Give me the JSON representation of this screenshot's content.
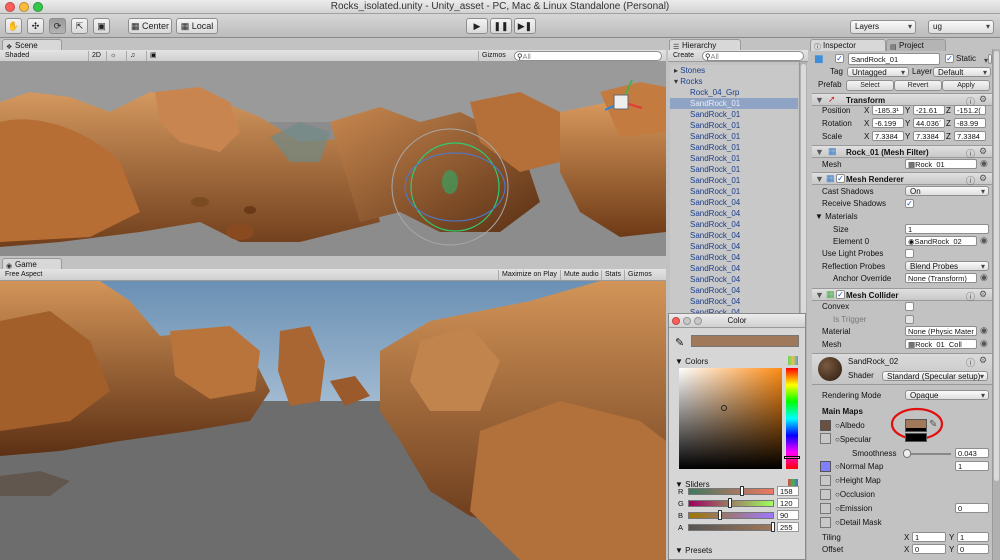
{
  "window": {
    "title": "Rocks_isolated.unity - Unity_asset - PC, Mac & Linux Standalone (Personal)"
  },
  "toolbar": {
    "pivot_label": "Center",
    "space_label": "Local",
    "layers_label": "Layers",
    "layout_label": "ug"
  },
  "scene": {
    "tab": "Scene",
    "shading": "Shaded",
    "mode_2d": "2D",
    "gizmos": "Gizmos",
    "search_placeholder": "All"
  },
  "game": {
    "tab": "Game",
    "aspect": "Free Aspect",
    "buttons": [
      "Maximize on Play",
      "Mute audio",
      "Stats",
      "Gizmos"
    ]
  },
  "hierarchy": {
    "tab": "Hierarchy",
    "create": "Create",
    "search_placeholder": "All",
    "items": [
      {
        "label": "Stones",
        "indent": 0,
        "expand": "closed",
        "selected": false
      },
      {
        "label": "Rocks",
        "indent": 0,
        "expand": "open",
        "selected": false
      },
      {
        "label": "Rock_04_Grp",
        "indent": 1,
        "expand": "",
        "selected": false
      },
      {
        "label": "SandRock_01",
        "indent": 1,
        "expand": "",
        "selected": true
      },
      {
        "label": "SandRock_01",
        "indent": 1,
        "expand": "",
        "selected": false
      },
      {
        "label": "SandRock_01",
        "indent": 1,
        "expand": "",
        "selected": false
      },
      {
        "label": "SandRock_01",
        "indent": 1,
        "expand": "",
        "selected": false
      },
      {
        "label": "SandRock_01",
        "indent": 1,
        "expand": "",
        "selected": false
      },
      {
        "label": "SandRock_01",
        "indent": 1,
        "expand": "",
        "selected": false
      },
      {
        "label": "SandRock_01",
        "indent": 1,
        "expand": "",
        "selected": false
      },
      {
        "label": "SandRock_01",
        "indent": 1,
        "expand": "",
        "selected": false
      },
      {
        "label": "SandRock_01",
        "indent": 1,
        "expand": "",
        "selected": false
      },
      {
        "label": "SandRock_04",
        "indent": 1,
        "expand": "",
        "selected": false
      },
      {
        "label": "SandRock_04",
        "indent": 1,
        "expand": "",
        "selected": false
      },
      {
        "label": "SandRock_04",
        "indent": 1,
        "expand": "",
        "selected": false
      },
      {
        "label": "SandRock_04",
        "indent": 1,
        "expand": "",
        "selected": false
      },
      {
        "label": "SandRock_04",
        "indent": 1,
        "expand": "",
        "selected": false
      },
      {
        "label": "SandRock_04",
        "indent": 1,
        "expand": "",
        "selected": false
      },
      {
        "label": "SandRock_04",
        "indent": 1,
        "expand": "",
        "selected": false
      },
      {
        "label": "SandRock_04",
        "indent": 1,
        "expand": "",
        "selected": false
      },
      {
        "label": "SandRock_04",
        "indent": 1,
        "expand": "",
        "selected": false
      },
      {
        "label": "SandRock_04",
        "indent": 1,
        "expand": "",
        "selected": false
      },
      {
        "label": "SandRock_04",
        "indent": 1,
        "expand": "",
        "selected": false
      }
    ]
  },
  "color_picker": {
    "title": "Color",
    "swatch": "#a0785a",
    "colors_label": "Colors",
    "sliders_label": "Sliders",
    "presets_label": "Presets",
    "sliders": [
      {
        "channel": "R",
        "value": "158",
        "fraction": 0.62
      },
      {
        "channel": "G",
        "value": "120",
        "fraction": 0.47
      },
      {
        "channel": "B",
        "value": "90",
        "fraction": 0.35
      },
      {
        "channel": "A",
        "value": "255",
        "fraction": 1.0
      }
    ]
  },
  "inspector": {
    "tab": "Inspector",
    "project_tab": "Project",
    "object_name": "SandRock_01",
    "static_label": "Static",
    "tag_label": "Tag",
    "tag_value": "Untagged",
    "layer_label": "Layer",
    "layer_value": "Default",
    "prefab_label": "Prefab",
    "prefab_buttons": [
      "Select",
      "Revert",
      "Apply"
    ],
    "transform": {
      "title": "Transform",
      "rows": [
        {
          "label": "Position",
          "x": "-185.3¹",
          "y": "-21.61",
          "z": "-151.2("
        },
        {
          "label": "Rotation",
          "x": "-6.199",
          "y": "44.036´",
          "z": "-83.99"
        },
        {
          "label": "Scale",
          "x": "7.3384",
          "y": "7.3384",
          "z": "7.3384"
        }
      ]
    },
    "mesh_filter": {
      "title": "Rock_01 (Mesh Filter)",
      "mesh_label": "Mesh",
      "mesh_value": "Rock_01"
    },
    "mesh_renderer": {
      "title": "Mesh Renderer",
      "cast_shadows_label": "Cast Shadows",
      "cast_shadows_value": "On",
      "receive_shadows_label": "Receive Shadows",
      "materials_label": "Materials",
      "size_label": "Size",
      "size_value": "1",
      "element0_label": "Element 0",
      "element0_value": "SandRock_02",
      "light_probes_label": "Use Light Probes",
      "reflection_probes_label": "Reflection Probes",
      "reflection_probes_value": "Blend Probes",
      "anchor_override_label": "Anchor Override",
      "anchor_override_value": "None (Transform)"
    },
    "mesh_collider": {
      "title": "Mesh Collider",
      "convex_label": "Convex",
      "is_trigger_label": "Is Trigger",
      "material_label": "Material",
      "material_value": "None (Physic Mater",
      "mesh_label": "Mesh",
      "mesh_value": "Rock_01_Coll"
    },
    "material": {
      "name": "SandRock_02",
      "shader_label": "Shader",
      "shader_value": "Standard (Specular setup)",
      "rendering_mode_label": "Rendering Mode",
      "rendering_mode_value": "Opaque",
      "main_maps_label": "Main Maps",
      "albedo_label": "Albedo",
      "albedo_color": "#a0785a",
      "specular_label": "Specular",
      "smoothness_label": "Smoothness",
      "smoothness_value": "0.043",
      "normal_map_label": "Normal Map",
      "normal_map_value": "1",
      "height_map_label": "Height Map",
      "occlusion_label": "Occlusion",
      "emission_label": "Emission",
      "emission_value": "0",
      "detail_mask_label": "Detail Mask",
      "tiling_label": "Tiling",
      "tiling_x": "1",
      "tiling_y": "1",
      "offset_label": "Offset",
      "offset_x": "0",
      "offset_y": "0"
    }
  },
  "colors": {
    "panel": "#c2c2c2",
    "selection": "#8fa3c4",
    "rock": "#b06a30",
    "sky": "#a8c0d4",
    "annotation": "#e01010"
  }
}
